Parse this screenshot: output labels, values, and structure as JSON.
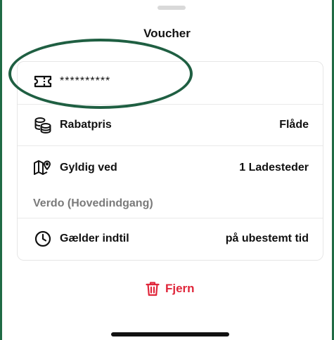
{
  "sheet": {
    "title": "Voucher"
  },
  "voucher": {
    "code_masked": "**********"
  },
  "details": {
    "discount": {
      "label": "Rabatpris",
      "value": "Flåde"
    },
    "valid_at": {
      "label": "Gyldig ved",
      "value": "1 Ladesteder",
      "location": "Verdo (Hovedindgang)"
    },
    "valid_until": {
      "label": "Gælder indtil",
      "value": "på ubestemt tid"
    }
  },
  "actions": {
    "remove_label": "Fjern"
  },
  "colors": {
    "accent_green": "#1f5f42",
    "danger_red": "#e0263a"
  },
  "icons": [
    "ticket-icon",
    "coins-icon",
    "map-pin-icon",
    "clock-icon",
    "trash-icon"
  ]
}
